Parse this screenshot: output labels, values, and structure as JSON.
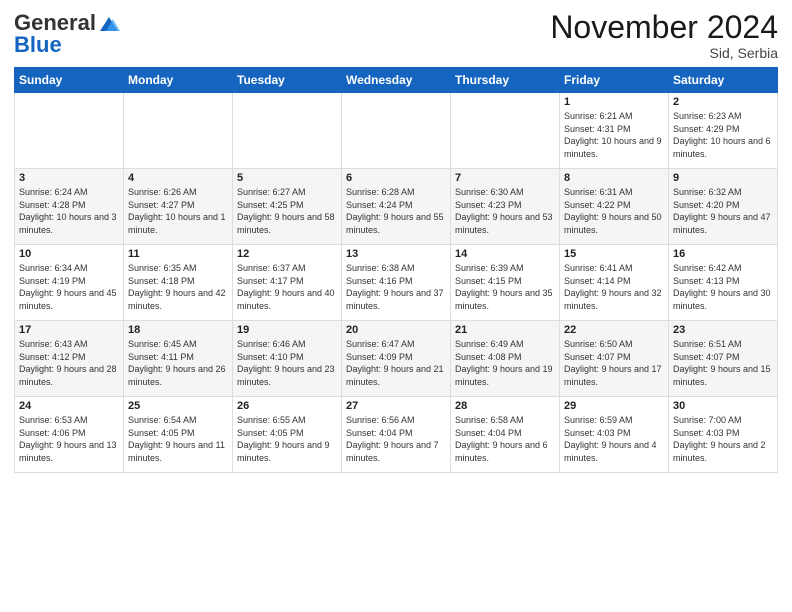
{
  "header": {
    "logo_line1": "General",
    "logo_line2": "Blue",
    "month_title": "November 2024",
    "subtitle": "Sid, Serbia"
  },
  "weekdays": [
    "Sunday",
    "Monday",
    "Tuesday",
    "Wednesday",
    "Thursday",
    "Friday",
    "Saturday"
  ],
  "weeks": [
    [
      {
        "day": "",
        "info": ""
      },
      {
        "day": "",
        "info": ""
      },
      {
        "day": "",
        "info": ""
      },
      {
        "day": "",
        "info": ""
      },
      {
        "day": "",
        "info": ""
      },
      {
        "day": "1",
        "info": "Sunrise: 6:21 AM\nSunset: 4:31 PM\nDaylight: 10 hours and 9 minutes."
      },
      {
        "day": "2",
        "info": "Sunrise: 6:23 AM\nSunset: 4:29 PM\nDaylight: 10 hours and 6 minutes."
      }
    ],
    [
      {
        "day": "3",
        "info": "Sunrise: 6:24 AM\nSunset: 4:28 PM\nDaylight: 10 hours and 3 minutes."
      },
      {
        "day": "4",
        "info": "Sunrise: 6:26 AM\nSunset: 4:27 PM\nDaylight: 10 hours and 1 minute."
      },
      {
        "day": "5",
        "info": "Sunrise: 6:27 AM\nSunset: 4:25 PM\nDaylight: 9 hours and 58 minutes."
      },
      {
        "day": "6",
        "info": "Sunrise: 6:28 AM\nSunset: 4:24 PM\nDaylight: 9 hours and 55 minutes."
      },
      {
        "day": "7",
        "info": "Sunrise: 6:30 AM\nSunset: 4:23 PM\nDaylight: 9 hours and 53 minutes."
      },
      {
        "day": "8",
        "info": "Sunrise: 6:31 AM\nSunset: 4:22 PM\nDaylight: 9 hours and 50 minutes."
      },
      {
        "day": "9",
        "info": "Sunrise: 6:32 AM\nSunset: 4:20 PM\nDaylight: 9 hours and 47 minutes."
      }
    ],
    [
      {
        "day": "10",
        "info": "Sunrise: 6:34 AM\nSunset: 4:19 PM\nDaylight: 9 hours and 45 minutes."
      },
      {
        "day": "11",
        "info": "Sunrise: 6:35 AM\nSunset: 4:18 PM\nDaylight: 9 hours and 42 minutes."
      },
      {
        "day": "12",
        "info": "Sunrise: 6:37 AM\nSunset: 4:17 PM\nDaylight: 9 hours and 40 minutes."
      },
      {
        "day": "13",
        "info": "Sunrise: 6:38 AM\nSunset: 4:16 PM\nDaylight: 9 hours and 37 minutes."
      },
      {
        "day": "14",
        "info": "Sunrise: 6:39 AM\nSunset: 4:15 PM\nDaylight: 9 hours and 35 minutes."
      },
      {
        "day": "15",
        "info": "Sunrise: 6:41 AM\nSunset: 4:14 PM\nDaylight: 9 hours and 32 minutes."
      },
      {
        "day": "16",
        "info": "Sunrise: 6:42 AM\nSunset: 4:13 PM\nDaylight: 9 hours and 30 minutes."
      }
    ],
    [
      {
        "day": "17",
        "info": "Sunrise: 6:43 AM\nSunset: 4:12 PM\nDaylight: 9 hours and 28 minutes."
      },
      {
        "day": "18",
        "info": "Sunrise: 6:45 AM\nSunset: 4:11 PM\nDaylight: 9 hours and 26 minutes."
      },
      {
        "day": "19",
        "info": "Sunrise: 6:46 AM\nSunset: 4:10 PM\nDaylight: 9 hours and 23 minutes."
      },
      {
        "day": "20",
        "info": "Sunrise: 6:47 AM\nSunset: 4:09 PM\nDaylight: 9 hours and 21 minutes."
      },
      {
        "day": "21",
        "info": "Sunrise: 6:49 AM\nSunset: 4:08 PM\nDaylight: 9 hours and 19 minutes."
      },
      {
        "day": "22",
        "info": "Sunrise: 6:50 AM\nSunset: 4:07 PM\nDaylight: 9 hours and 17 minutes."
      },
      {
        "day": "23",
        "info": "Sunrise: 6:51 AM\nSunset: 4:07 PM\nDaylight: 9 hours and 15 minutes."
      }
    ],
    [
      {
        "day": "24",
        "info": "Sunrise: 6:53 AM\nSunset: 4:06 PM\nDaylight: 9 hours and 13 minutes."
      },
      {
        "day": "25",
        "info": "Sunrise: 6:54 AM\nSunset: 4:05 PM\nDaylight: 9 hours and 11 minutes."
      },
      {
        "day": "26",
        "info": "Sunrise: 6:55 AM\nSunset: 4:05 PM\nDaylight: 9 hours and 9 minutes."
      },
      {
        "day": "27",
        "info": "Sunrise: 6:56 AM\nSunset: 4:04 PM\nDaylight: 9 hours and 7 minutes."
      },
      {
        "day": "28",
        "info": "Sunrise: 6:58 AM\nSunset: 4:04 PM\nDaylight: 9 hours and 6 minutes."
      },
      {
        "day": "29",
        "info": "Sunrise: 6:59 AM\nSunset: 4:03 PM\nDaylight: 9 hours and 4 minutes."
      },
      {
        "day": "30",
        "info": "Sunrise: 7:00 AM\nSunset: 4:03 PM\nDaylight: 9 hours and 2 minutes."
      }
    ]
  ]
}
